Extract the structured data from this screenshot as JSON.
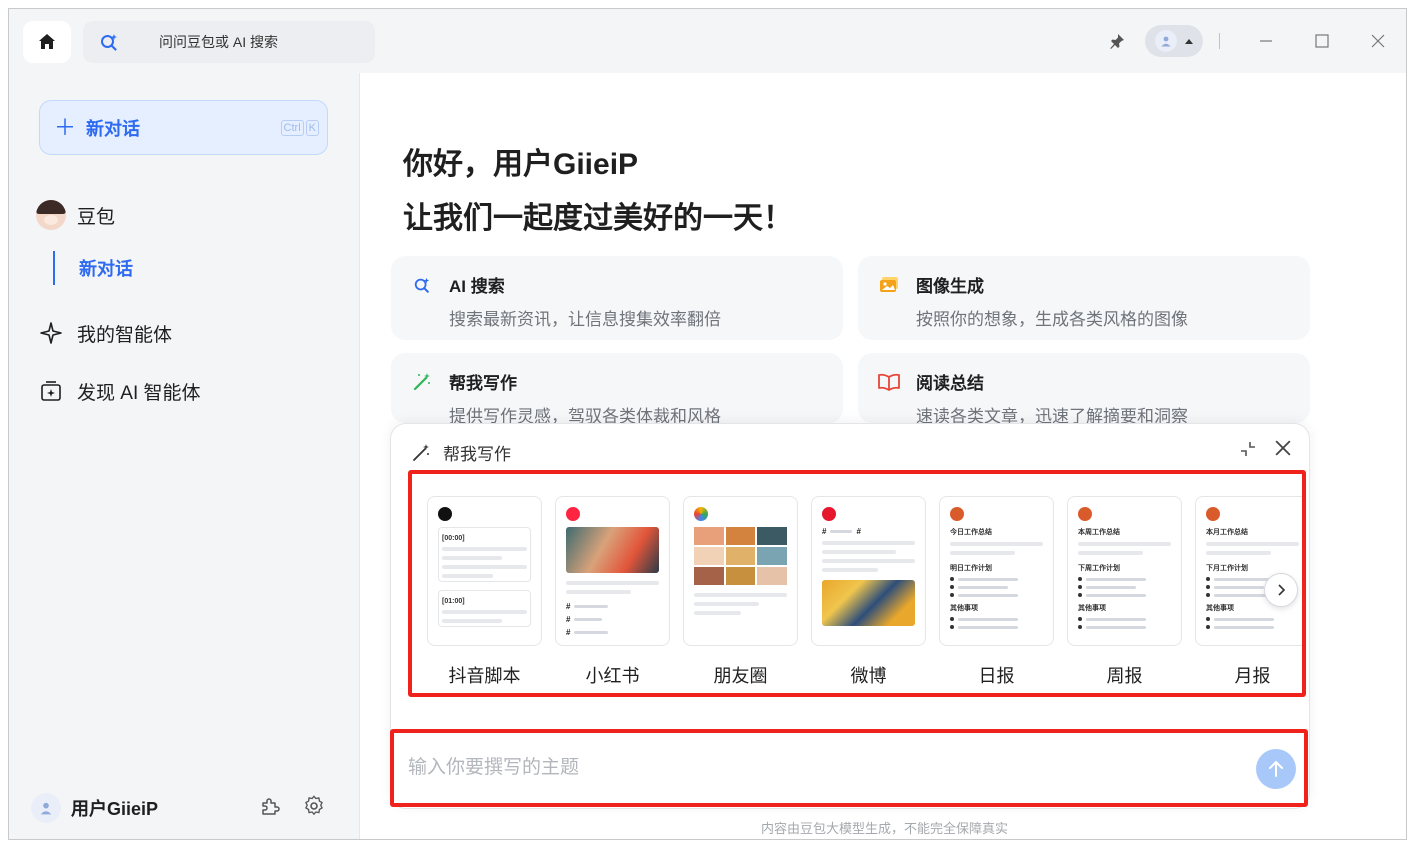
{
  "titlebar": {
    "search_placeholder": "问问豆包或 AI 搜索"
  },
  "sidebar": {
    "new_chat_label": "新对话",
    "shortcut": [
      "Ctrl",
      "K"
    ],
    "items": [
      {
        "label": "豆包"
      },
      {
        "label": "新对话"
      },
      {
        "label": "我的智能体"
      },
      {
        "label": "发现 AI 智能体"
      }
    ],
    "user_name": "用户GiieiP"
  },
  "main": {
    "greeting_line1": "你好，用户GiieiP",
    "greeting_line2": "让我们一起度过美好的一天！",
    "cards": [
      {
        "title": "AI 搜索",
        "desc": "搜索最新资讯，让信息搜集效率翻倍"
      },
      {
        "title": "图像生成",
        "desc": "按照你的想象，生成各类风格的图像"
      },
      {
        "title": "帮我写作",
        "desc": "提供写作灵感，驾驭各类体裁和风格"
      },
      {
        "title": "阅读总结",
        "desc": "速读各类文章，迅速了解摘要和洞察"
      }
    ],
    "panel": {
      "title": "帮我写作",
      "templates": [
        {
          "label": "抖音脚本",
          "ts1": "[00:00]",
          "ts2": "[01:00]",
          "badge": ""
        },
        {
          "label": "小红书",
          "badge": "小红书"
        },
        {
          "label": "朋友圈"
        },
        {
          "label": "微博"
        },
        {
          "label": "日报",
          "h1": "今日工作总结",
          "h2": "明日工作计划",
          "h3": "其他事项"
        },
        {
          "label": "周报",
          "h1": "本周工作总结",
          "h2": "下周工作计划",
          "h3": "其他事项"
        },
        {
          "label": "月报",
          "h1": "本月工作总结",
          "h2": "下月工作计划",
          "h3": "其他事项"
        }
      ],
      "input_placeholder": "输入你要撰写的主题"
    },
    "disclaimer": "内容由豆包大模型生成，不能完全保障真实"
  },
  "colors": {
    "accent": "#2e6bf0",
    "highlight_box": "#f0221c",
    "send_button": "#a9c8fa"
  }
}
